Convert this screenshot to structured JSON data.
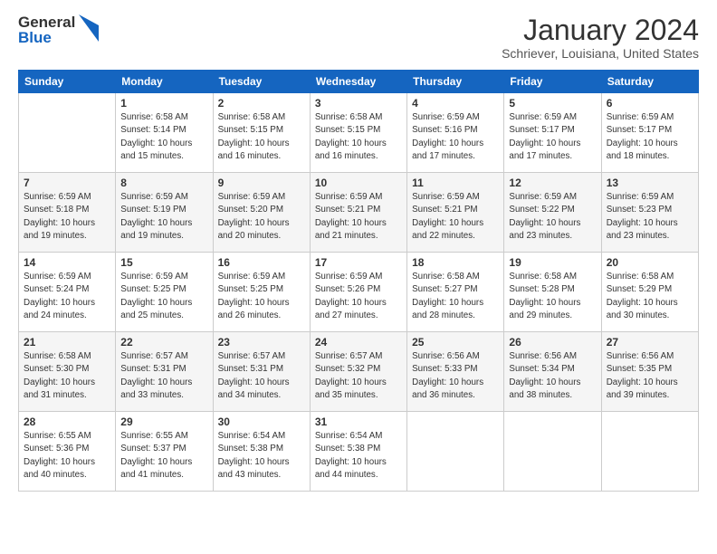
{
  "logo": {
    "general": "General",
    "blue": "Blue"
  },
  "title": "January 2024",
  "location": "Schriever, Louisiana, United States",
  "days_of_week": [
    "Sunday",
    "Monday",
    "Tuesday",
    "Wednesday",
    "Thursday",
    "Friday",
    "Saturday"
  ],
  "weeks": [
    [
      {
        "day": "",
        "info": ""
      },
      {
        "day": "1",
        "info": "Sunrise: 6:58 AM\nSunset: 5:14 PM\nDaylight: 10 hours\nand 15 minutes."
      },
      {
        "day": "2",
        "info": "Sunrise: 6:58 AM\nSunset: 5:15 PM\nDaylight: 10 hours\nand 16 minutes."
      },
      {
        "day": "3",
        "info": "Sunrise: 6:58 AM\nSunset: 5:15 PM\nDaylight: 10 hours\nand 16 minutes."
      },
      {
        "day": "4",
        "info": "Sunrise: 6:59 AM\nSunset: 5:16 PM\nDaylight: 10 hours\nand 17 minutes."
      },
      {
        "day": "5",
        "info": "Sunrise: 6:59 AM\nSunset: 5:17 PM\nDaylight: 10 hours\nand 17 minutes."
      },
      {
        "day": "6",
        "info": "Sunrise: 6:59 AM\nSunset: 5:17 PM\nDaylight: 10 hours\nand 18 minutes."
      }
    ],
    [
      {
        "day": "7",
        "info": "Sunrise: 6:59 AM\nSunset: 5:18 PM\nDaylight: 10 hours\nand 19 minutes."
      },
      {
        "day": "8",
        "info": "Sunrise: 6:59 AM\nSunset: 5:19 PM\nDaylight: 10 hours\nand 19 minutes."
      },
      {
        "day": "9",
        "info": "Sunrise: 6:59 AM\nSunset: 5:20 PM\nDaylight: 10 hours\nand 20 minutes."
      },
      {
        "day": "10",
        "info": "Sunrise: 6:59 AM\nSunset: 5:21 PM\nDaylight: 10 hours\nand 21 minutes."
      },
      {
        "day": "11",
        "info": "Sunrise: 6:59 AM\nSunset: 5:21 PM\nDaylight: 10 hours\nand 22 minutes."
      },
      {
        "day": "12",
        "info": "Sunrise: 6:59 AM\nSunset: 5:22 PM\nDaylight: 10 hours\nand 23 minutes."
      },
      {
        "day": "13",
        "info": "Sunrise: 6:59 AM\nSunset: 5:23 PM\nDaylight: 10 hours\nand 23 minutes."
      }
    ],
    [
      {
        "day": "14",
        "info": "Sunrise: 6:59 AM\nSunset: 5:24 PM\nDaylight: 10 hours\nand 24 minutes."
      },
      {
        "day": "15",
        "info": "Sunrise: 6:59 AM\nSunset: 5:25 PM\nDaylight: 10 hours\nand 25 minutes."
      },
      {
        "day": "16",
        "info": "Sunrise: 6:59 AM\nSunset: 5:25 PM\nDaylight: 10 hours\nand 26 minutes."
      },
      {
        "day": "17",
        "info": "Sunrise: 6:59 AM\nSunset: 5:26 PM\nDaylight: 10 hours\nand 27 minutes."
      },
      {
        "day": "18",
        "info": "Sunrise: 6:58 AM\nSunset: 5:27 PM\nDaylight: 10 hours\nand 28 minutes."
      },
      {
        "day": "19",
        "info": "Sunrise: 6:58 AM\nSunset: 5:28 PM\nDaylight: 10 hours\nand 29 minutes."
      },
      {
        "day": "20",
        "info": "Sunrise: 6:58 AM\nSunset: 5:29 PM\nDaylight: 10 hours\nand 30 minutes."
      }
    ],
    [
      {
        "day": "21",
        "info": "Sunrise: 6:58 AM\nSunset: 5:30 PM\nDaylight: 10 hours\nand 31 minutes."
      },
      {
        "day": "22",
        "info": "Sunrise: 6:57 AM\nSunset: 5:31 PM\nDaylight: 10 hours\nand 33 minutes."
      },
      {
        "day": "23",
        "info": "Sunrise: 6:57 AM\nSunset: 5:31 PM\nDaylight: 10 hours\nand 34 minutes."
      },
      {
        "day": "24",
        "info": "Sunrise: 6:57 AM\nSunset: 5:32 PM\nDaylight: 10 hours\nand 35 minutes."
      },
      {
        "day": "25",
        "info": "Sunrise: 6:56 AM\nSunset: 5:33 PM\nDaylight: 10 hours\nand 36 minutes."
      },
      {
        "day": "26",
        "info": "Sunrise: 6:56 AM\nSunset: 5:34 PM\nDaylight: 10 hours\nand 38 minutes."
      },
      {
        "day": "27",
        "info": "Sunrise: 6:56 AM\nSunset: 5:35 PM\nDaylight: 10 hours\nand 39 minutes."
      }
    ],
    [
      {
        "day": "28",
        "info": "Sunrise: 6:55 AM\nSunset: 5:36 PM\nDaylight: 10 hours\nand 40 minutes."
      },
      {
        "day": "29",
        "info": "Sunrise: 6:55 AM\nSunset: 5:37 PM\nDaylight: 10 hours\nand 41 minutes."
      },
      {
        "day": "30",
        "info": "Sunrise: 6:54 AM\nSunset: 5:38 PM\nDaylight: 10 hours\nand 43 minutes."
      },
      {
        "day": "31",
        "info": "Sunrise: 6:54 AM\nSunset: 5:38 PM\nDaylight: 10 hours\nand 44 minutes."
      },
      {
        "day": "",
        "info": ""
      },
      {
        "day": "",
        "info": ""
      },
      {
        "day": "",
        "info": ""
      }
    ]
  ]
}
